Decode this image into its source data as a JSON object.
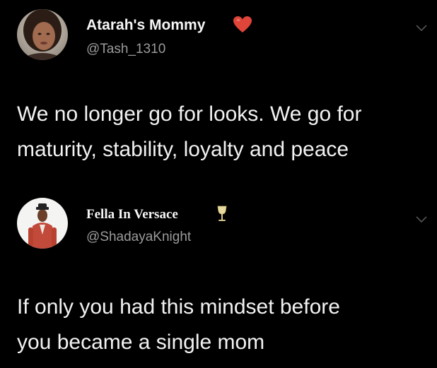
{
  "tweets": [
    {
      "display_name": "Atarah's Mommy",
      "badge_icon": "red-heart-icon",
      "handle": "@Tash_1310",
      "text_lines": [
        "We no longer go for looks. We go for",
        "maturity, stability, loyalty and peace"
      ],
      "avatar": "profile-photo"
    },
    {
      "display_name": "Fella In Versace",
      "badge_icon": "wine-glass-icon",
      "handle": "@ShadayaKnight",
      "text_lines": [
        "If only you had this mindset before",
        "you became a single mom"
      ],
      "avatar": "profile-photo"
    }
  ],
  "colors": {
    "background": "#000000",
    "text": "#f2f2f2",
    "handle": "#9a9a9a",
    "heart": "#e0453a",
    "caret": "#555555"
  }
}
